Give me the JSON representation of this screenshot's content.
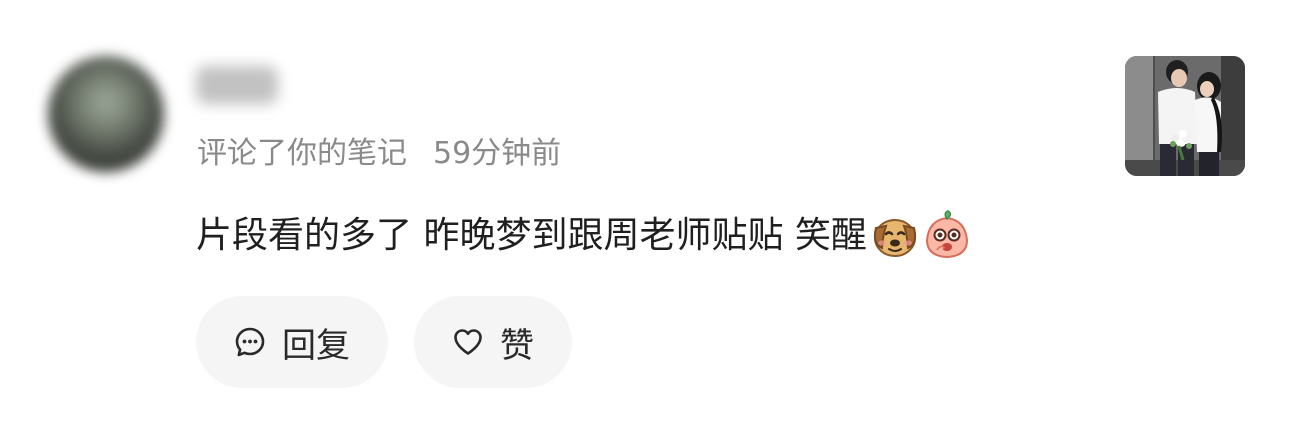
{
  "notification": {
    "username": "",
    "action": "评论了你的笔记",
    "time": "59分钟前",
    "comment_text": "片段看的多了 昨晚梦到跟周老师贴贴 笑醒",
    "emojis": [
      "dog-emoji",
      "peach-face-emoji"
    ]
  },
  "actions": {
    "reply_label": "回复",
    "like_label": "赞"
  },
  "colors": {
    "background": "#ffffff",
    "button_bg": "#f5f5f5",
    "meta_text": "#8a8a8a",
    "body_text": "#1f1f1f"
  }
}
